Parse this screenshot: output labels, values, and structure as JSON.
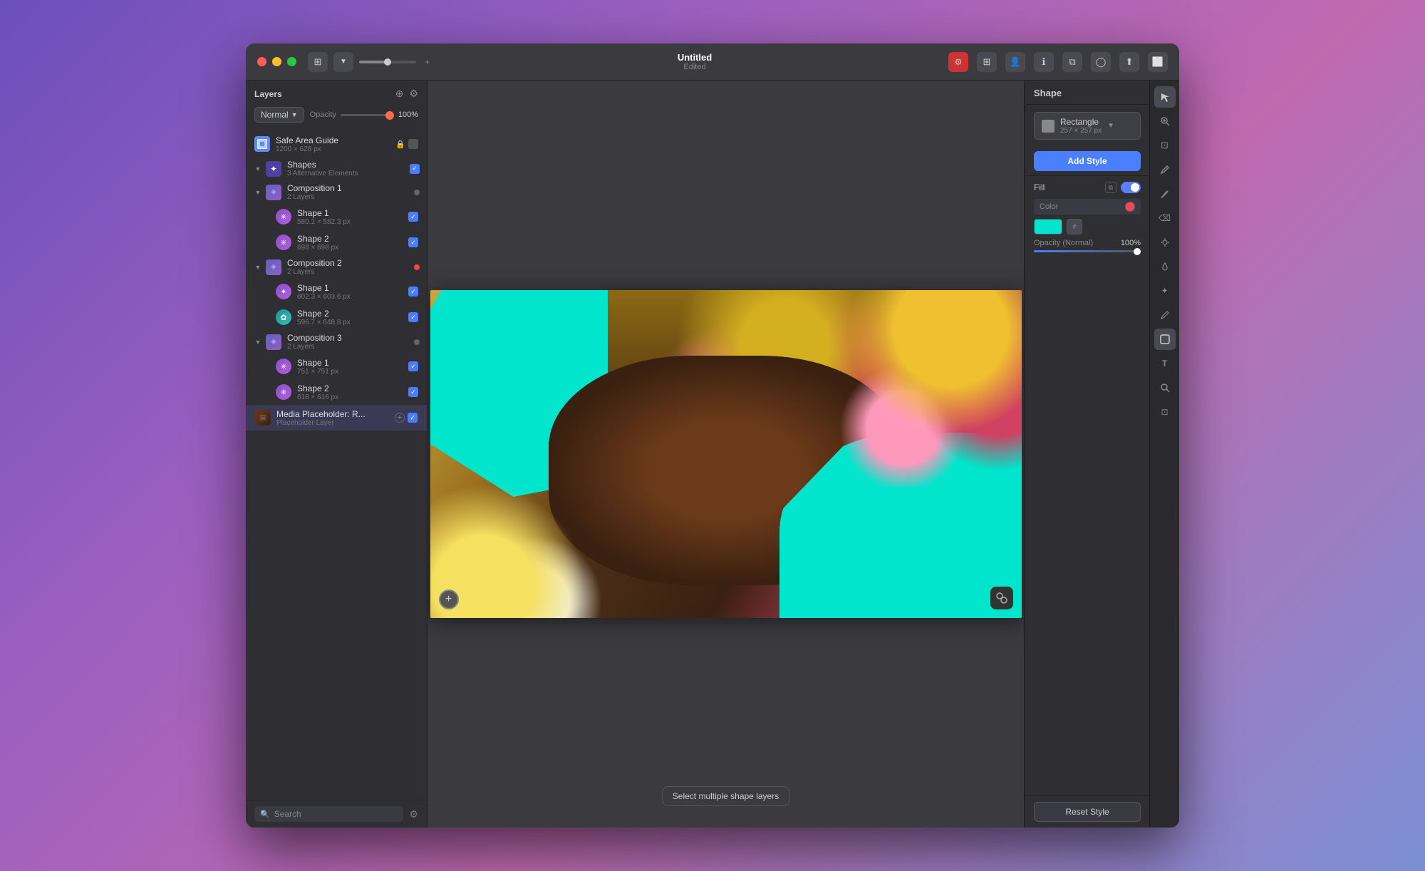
{
  "window": {
    "title": "Untitled",
    "subtitle": "Edited"
  },
  "layers_panel": {
    "title": "Layers",
    "blend_mode": "Normal",
    "opacity_label": "Opacity",
    "opacity_value": "100%",
    "layers": [
      {
        "id": "safe-area",
        "name": "Safe Area Guide",
        "size": "1200 × 628 px",
        "icon_type": "blue",
        "indent": 0,
        "locked": true,
        "visible": false
      },
      {
        "id": "shapes-group",
        "name": "Shapes",
        "sublabel": "3 Alternative Elements",
        "icon_type": "group",
        "indent": 0,
        "checked": true,
        "is_group": true,
        "expanded": true
      },
      {
        "id": "comp1",
        "name": "Composition 1",
        "sublabel": "2 Layers",
        "icon_type": "comp",
        "indent": 1,
        "is_group": true,
        "expanded": true
      },
      {
        "id": "comp1-shape1",
        "name": "Shape 1",
        "size": "580.1 × 582.3 px",
        "icon_type": "purple-star",
        "indent": 2,
        "checked": true
      },
      {
        "id": "comp1-shape2",
        "name": "Shape 2",
        "size": "698 × 698 px",
        "icon_type": "purple-star",
        "indent": 2,
        "checked": true
      },
      {
        "id": "comp2",
        "name": "Composition 2",
        "sublabel": "2 Layers",
        "icon_type": "comp",
        "indent": 1,
        "is_group": true,
        "expanded": true,
        "dot_red": true
      },
      {
        "id": "comp2-shape1",
        "name": "Shape 1",
        "size": "602.3 × 603.6 px",
        "icon_type": "purple-flower",
        "indent": 2,
        "checked": true
      },
      {
        "id": "comp2-shape2",
        "name": "Shape 2",
        "size": "596.7 × 648.8 px",
        "icon_type": "teal-flower",
        "indent": 2,
        "checked": true
      },
      {
        "id": "comp3",
        "name": "Composition 3",
        "sublabel": "2 Layers",
        "icon_type": "comp",
        "indent": 1,
        "is_group": true,
        "expanded": true
      },
      {
        "id": "comp3-shape1",
        "name": "Shape 1",
        "size": "751 × 751 px",
        "icon_type": "purple-star",
        "indent": 2,
        "checked": true
      },
      {
        "id": "comp3-shape2",
        "name": "Shape 2",
        "size": "618 × 616 px",
        "icon_type": "purple-star",
        "indent": 2,
        "checked": true
      },
      {
        "id": "media-placeholder",
        "name": "Media Placeholder: R...",
        "sublabel": "Placeholder Layer",
        "icon_type": "media",
        "indent": 0,
        "has_plus": true,
        "checked": true,
        "is_selected": true
      }
    ],
    "search_placeholder": "Search"
  },
  "canvas": {
    "select_hint": "Select multiple shape layers"
  },
  "props_panel": {
    "title": "Shape",
    "shape_name": "Rectangle",
    "shape_size": "257 × 257 px",
    "add_style_label": "Add Style",
    "fill_label": "Fill",
    "color_type": "Color",
    "opacity_label": "Opacity (Normal)",
    "opacity_value": "100%",
    "reset_style_label": "Reset Style"
  },
  "toolbar": {
    "tools": [
      "cursor",
      "zoom-in",
      "pencil",
      "eraser",
      "paint-bucket",
      "eyedropper",
      "sun",
      "drop",
      "wand",
      "pen",
      "frame",
      "text",
      "search",
      "crop"
    ]
  }
}
